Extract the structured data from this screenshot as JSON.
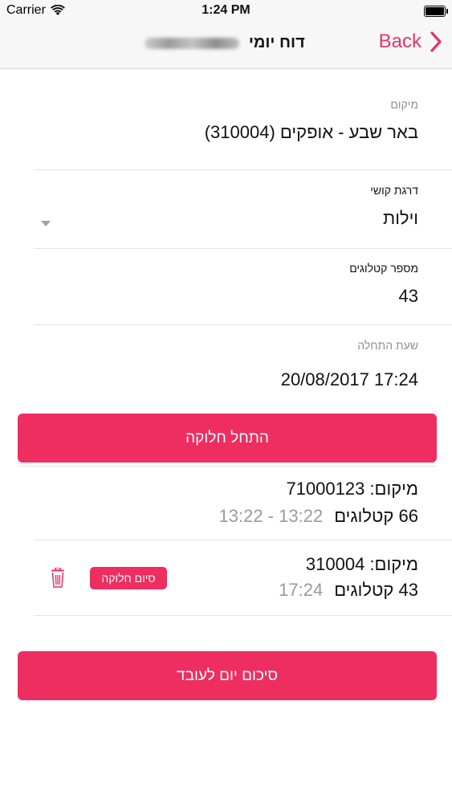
{
  "status_bar": {
    "carrier": "Carrier",
    "time": "1:24 PM"
  },
  "nav": {
    "title": "דוח יומי",
    "back_label": "Back"
  },
  "form": {
    "location_label": "מיקום",
    "location_value": "באר שבע - אופקים (310004)",
    "difficulty_label": "דרגת קושי",
    "difficulty_value": "וילות",
    "catalog_count_label": "מספר קטלוגים",
    "catalog_count_value": "43",
    "start_time_label": "שעת התחלה",
    "start_time_value": "17:24 20/08/2017"
  },
  "start_button_label": "התחל חלוקה",
  "distributions": [
    {
      "location_line": "מיקום: 71000123",
      "count": "66 קטלוגים",
      "time": "13:22 - 13:22"
    },
    {
      "location_line": "מיקום: 310004",
      "count": "43 קטלוגים",
      "time": "17:24",
      "end_button_label": "סיום חלוקה"
    }
  ],
  "summary_button_label": "סיכום יום לעובד",
  "colors": {
    "accent": "#ee2d60",
    "back_text": "#e8336a",
    "muted_text": "#8e8e93"
  },
  "icons": [
    "wifi-icon",
    "battery-icon",
    "chevron-right-icon",
    "dropdown-arrow-icon",
    "trash-icon"
  ]
}
